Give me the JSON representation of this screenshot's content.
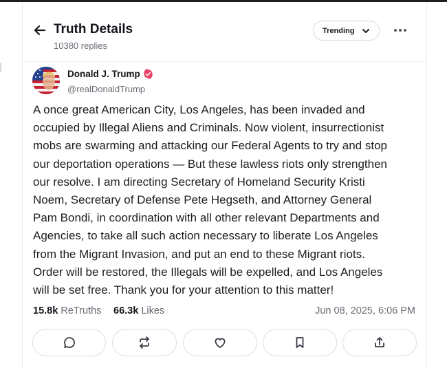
{
  "header": {
    "title": "Truth Details",
    "replies": "10380 replies",
    "trending_label": "Trending"
  },
  "post": {
    "author_name": "Donald J. Trump",
    "author_handle": "@realDonaldTrump",
    "body": "A once great American City, Los Angeles, has been invaded and\noccupied by Illegal Aliens and Criminals.  Now violent, insurrectionist\nmobs are swarming and attacking our Federal Agents to try and stop\nour deportation operations — But these lawless riots only strengthen\nour resolve. I am directing Secretary of Homeland Security Kristi\nNoem, Secretary of Defense Pete Hegseth, and Attorney General\nPam Bondi, in coordination with all other relevant Departments and\nAgencies, to take all such action necessary to liberate Los Angeles\nfrom the Migrant Invasion, and put an end to these Migrant riots.\nOrder will be restored, the Illegals will be expelled, and Los Angeles\nwill be set free. Thank you for your attention to this matter!",
    "retruths_count": "15.8k",
    "retruths_label": "ReTruths",
    "likes_count": "66.3k",
    "likes_label": "Likes",
    "timestamp": "Jun 08, 2025, 6:06 PM"
  },
  "icons": {
    "back": "arrow-left-icon",
    "trending_chevron": "chevron-down-icon",
    "more": "more-horizontal-icon",
    "verified": "verified-badge-icon",
    "actions": [
      "comment-icon",
      "retruth-icon",
      "heart-icon",
      "bookmark-icon",
      "share-icon"
    ]
  },
  "colors": {
    "verified_badge": "#e8456b",
    "text_primary": "#14141a",
    "text_secondary": "#6b6b76",
    "border": "#dedee4"
  }
}
